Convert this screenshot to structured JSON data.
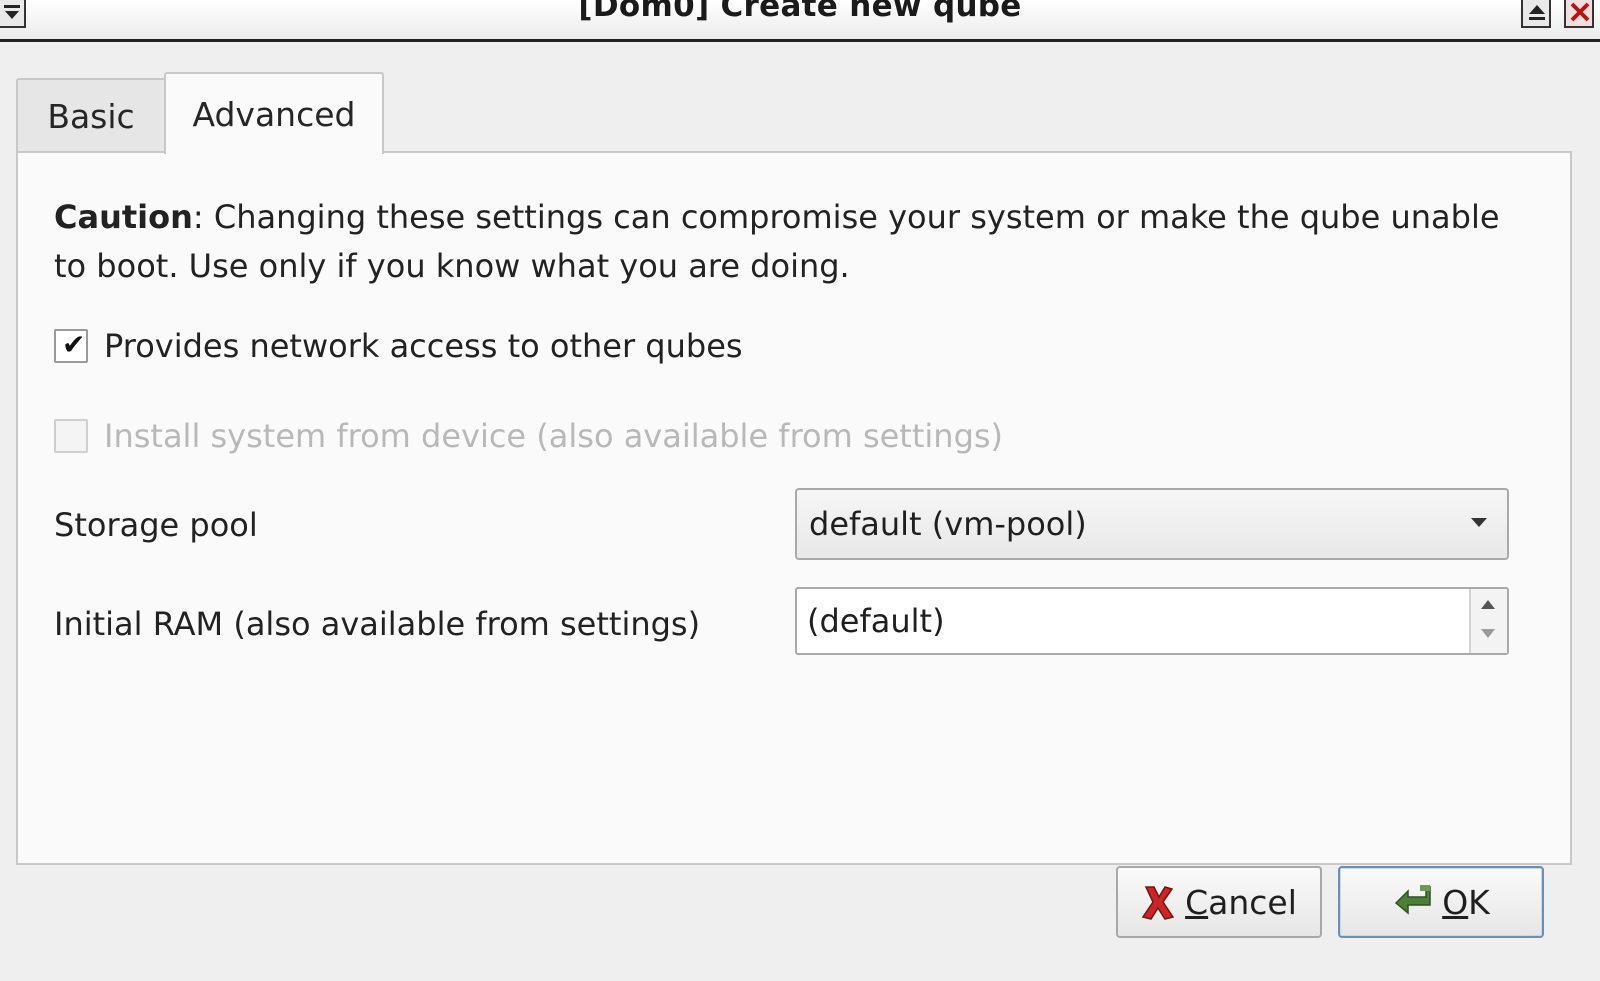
{
  "window": {
    "title": "[Dom0] Create new qube"
  },
  "tabs": [
    {
      "label": "Basic",
      "active": false
    },
    {
      "label": "Advanced",
      "active": true
    }
  ],
  "advanced": {
    "caution_bold": "Caution",
    "caution_text": ": Changing these settings can compromise your system or make the qube unable to boot. Use only if you know what you are doing.",
    "provides_network": {
      "label": "Provides network access to other qubes",
      "checked": true,
      "enabled": true
    },
    "install_from_device": {
      "label": "Install system from device (also available from settings)",
      "checked": false,
      "enabled": false
    },
    "storage_pool": {
      "label": "Storage pool",
      "value": "default (vm-pool)"
    },
    "initial_ram": {
      "label": "Initial RAM (also available from settings)",
      "value": "(default)"
    }
  },
  "buttons": {
    "cancel_label": "Cancel",
    "ok_label": "OK"
  },
  "icons": {
    "window_menu": "window-menu-icon",
    "maximize": "maximize-icon",
    "close": "close-icon",
    "cancel": "red-x-icon",
    "ok": "green-check-arrow-icon"
  }
}
